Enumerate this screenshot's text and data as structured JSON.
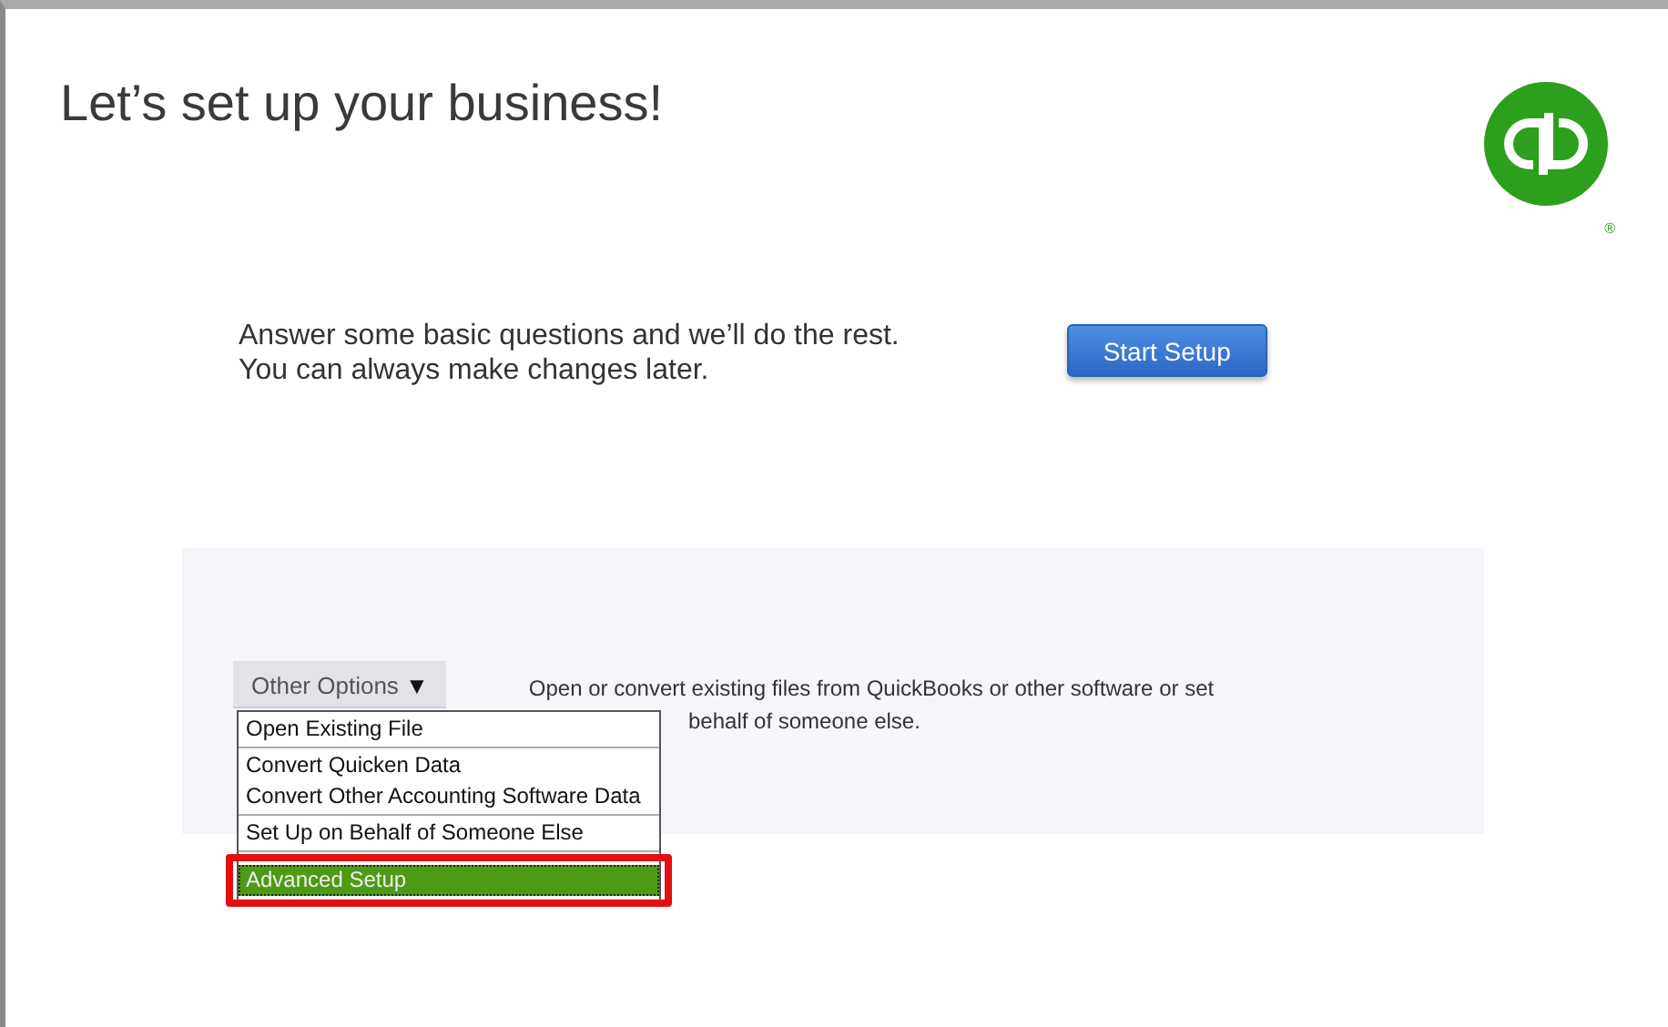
{
  "title": "Let’s set up your business!",
  "logo": {
    "mark": "®"
  },
  "intro": [
    "Answer some basic questions and we’ll do the rest.",
    "You can always make changes later."
  ],
  "start_button": "Start Setup",
  "other_options": {
    "label": "Other Options",
    "caret": "▼",
    "expanded": true,
    "description": [
      "Open or convert existing files from QuickBooks or other software or set",
      "behalf of someone else."
    ],
    "menu": [
      [
        {
          "label": "Open Existing File",
          "selected": false,
          "highlighted": false
        }
      ],
      [
        {
          "label": "Convert Quicken Data",
          "selected": false,
          "highlighted": false
        },
        {
          "label": "Convert Other Accounting Software Data",
          "selected": false,
          "highlighted": false
        }
      ],
      [
        {
          "label": "Set Up on Behalf of Someone Else",
          "selected": false,
          "highlighted": false
        }
      ],
      [
        {
          "label": "Advanced Setup",
          "selected": true,
          "highlighted": true
        }
      ]
    ]
  }
}
